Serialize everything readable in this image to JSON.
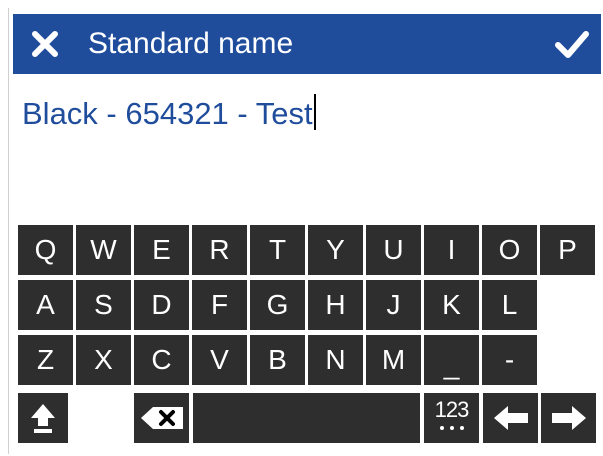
{
  "header": {
    "title": "Standard name",
    "close_icon": "close-icon",
    "confirm_icon": "checkmark-icon",
    "bg_color": "#1f4d9c"
  },
  "input": {
    "value": "Black - 654321 - Test",
    "text_color": "#1f4d9c"
  },
  "keyboard": {
    "row1": [
      "Q",
      "W",
      "E",
      "R",
      "T",
      "Y",
      "U",
      "I",
      "O",
      "P"
    ],
    "row2": [
      "A",
      "S",
      "D",
      "F",
      "G",
      "H",
      "J",
      "K",
      "L"
    ],
    "row3": [
      "Z",
      "X",
      "C",
      "V",
      "B",
      "N",
      "M",
      "_",
      "-"
    ],
    "mode_label": "123",
    "icons": {
      "shift": "shift-icon",
      "backspace": "backspace-icon",
      "space": "space-bar",
      "left": "arrow-left-icon",
      "right": "arrow-right-icon"
    },
    "key_color": "#2e2e2e"
  }
}
